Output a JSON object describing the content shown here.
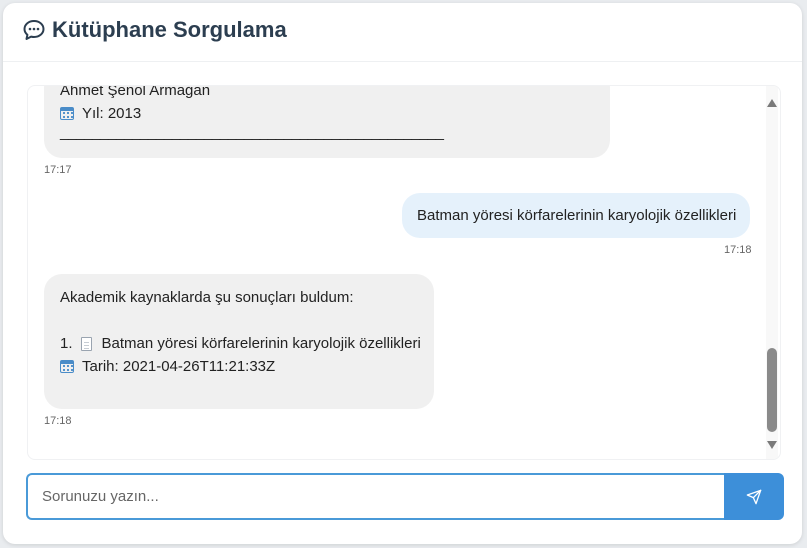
{
  "header": {
    "title": "Kütüphane Sorgulama",
    "icon": "chat-bubble-icon"
  },
  "messages": [
    {
      "role": "bot",
      "author_line": "Ahmet Şenol Armağan",
      "year_line": "Yıl: 2013",
      "separator": "________________________________________________",
      "time": "17:17"
    },
    {
      "role": "user",
      "text": "Batman yöresi körfarelerinin karyolojik özellikleri",
      "time": "17:18"
    },
    {
      "role": "bot",
      "intro": "Akademik kaynaklarda şu sonuçları buldum:",
      "result_number": "1.",
      "result_title": "Batman yöresi körfarelerinin karyolojik özellikleri",
      "date_line": "Tarih: 2021-04-26T11:21:33Z",
      "time": "17:18"
    }
  ],
  "composer": {
    "placeholder": "Sorunuzu yazın...",
    "send_icon": "paper-plane-icon"
  },
  "colors": {
    "accent": "#3d8fd9",
    "bot_bubble": "#f0f0f0",
    "user_bubble": "#e5f1fb",
    "title": "#2c3e50"
  }
}
